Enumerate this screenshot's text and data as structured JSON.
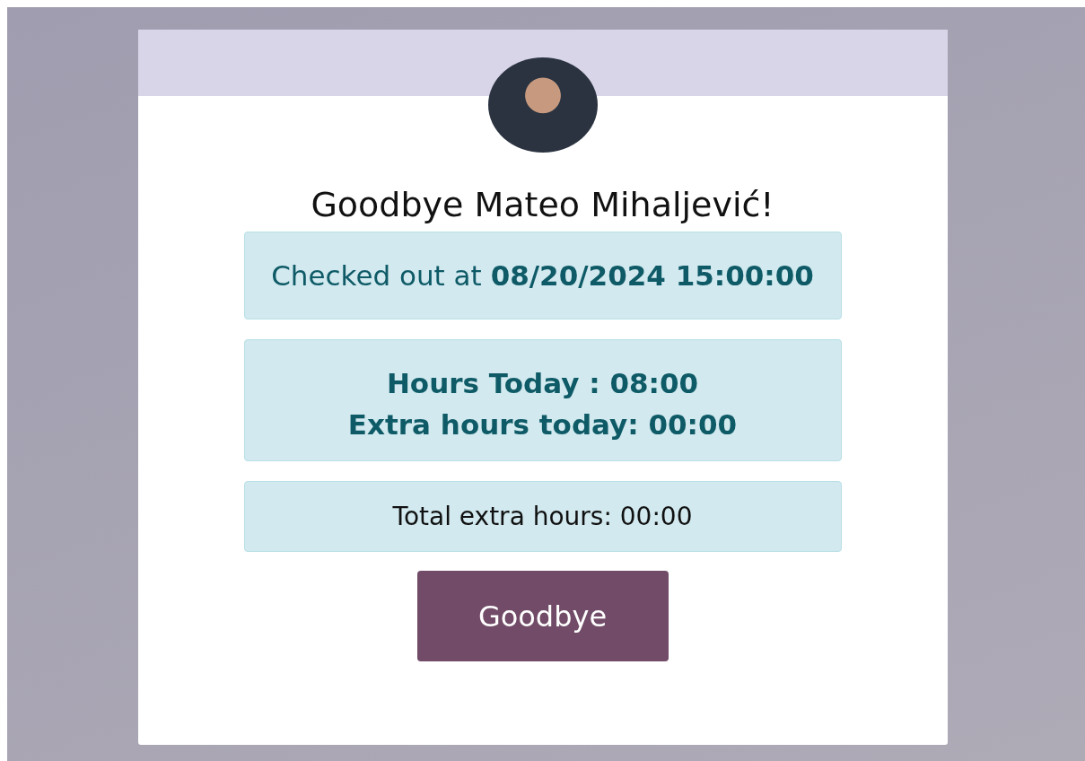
{
  "greeting": "Goodbye Mateo Mihaljević!",
  "check_out": "Checked out at **08/20/2024 15:00:00**",
  "hours": [
    "Hours Today : 08:00",
    "Extra hours today: 00:00"
  ],
  "total_extra": "Total extra hours: 00:00",
  "button": "Goodbye"
}
